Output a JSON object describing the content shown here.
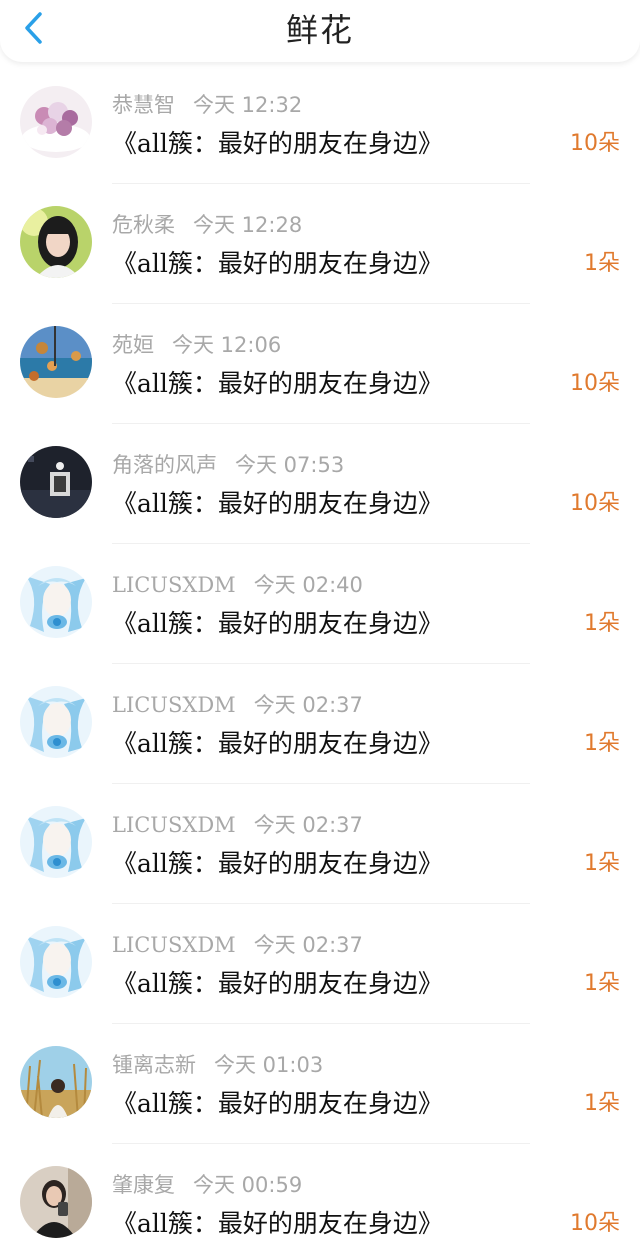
{
  "header": {
    "title": "鲜花",
    "back_icon": "chevron-left-icon",
    "accent_color": "#2aa0e8"
  },
  "count_color": "#e07a2e",
  "items": [
    {
      "name": "恭慧智",
      "time": "今天 12:32",
      "book": "《all簇：最好的朋友在身边》",
      "count": "10朵",
      "avatar": "flowers-avatar"
    },
    {
      "name": "危秋柔",
      "time": "今天 12:28",
      "book": "《all簇：最好的朋友在身边》",
      "count": "1朵",
      "avatar": "girl-avatar"
    },
    {
      "name": "苑姮",
      "time": "今天 12:06",
      "book": "《all簇：最好的朋友在身边》",
      "count": "10朵",
      "avatar": "beach-avatar"
    },
    {
      "name": "角落的风声",
      "time": "今天 07:53",
      "book": "《all簇：最好的朋友在身边》",
      "count": "10朵",
      "avatar": "dark-avatar"
    },
    {
      "name": "LICUSXDM",
      "time": "今天 02:40",
      "book": "《all簇：最好的朋友在身边》",
      "count": "1朵",
      "avatar": "anime-avatar"
    },
    {
      "name": "LICUSXDM",
      "time": "今天 02:37",
      "book": "《all簇：最好的朋友在身边》",
      "count": "1朵",
      "avatar": "anime-avatar"
    },
    {
      "name": "LICUSXDM",
      "time": "今天 02:37",
      "book": "《all簇：最好的朋友在身边》",
      "count": "1朵",
      "avatar": "anime-avatar"
    },
    {
      "name": "LICUSXDM",
      "time": "今天 02:37",
      "book": "《all簇：最好的朋友在身边》",
      "count": "1朵",
      "avatar": "anime-avatar"
    },
    {
      "name": "锺离志新",
      "time": "今天 01:03",
      "book": "《all簇：最好的朋友在身边》",
      "count": "1朵",
      "avatar": "reeds-avatar"
    },
    {
      "name": "肇康复",
      "time": "今天 00:59",
      "book": "《all簇：最好的朋友在身边》",
      "count": "10朵",
      "avatar": "selfie-avatar"
    }
  ]
}
